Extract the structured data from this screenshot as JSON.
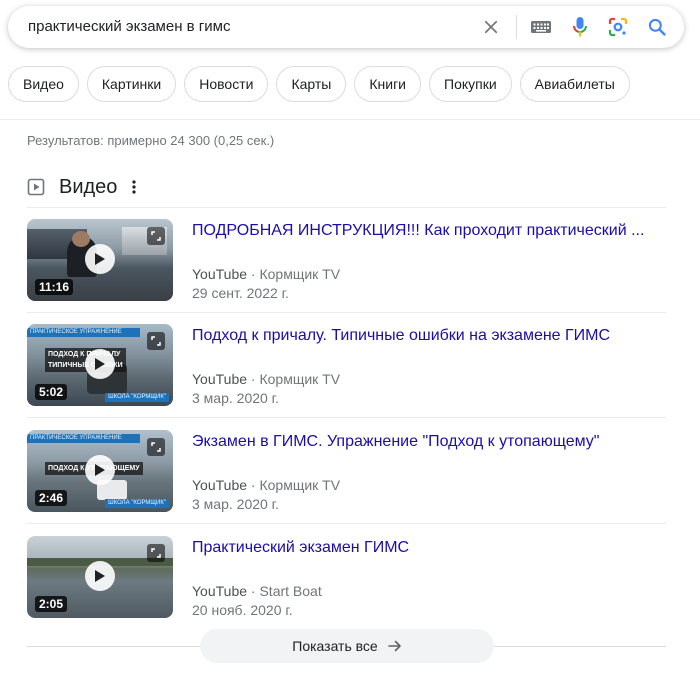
{
  "search": {
    "query": "практический экзамен в гимс"
  },
  "chips": [
    "Видео",
    "Картинки",
    "Новости",
    "Карты",
    "Книги",
    "Покупки",
    "Авиабилеты"
  ],
  "result_stats": "Результатов: примерно 24 300 (0,25 сек.)",
  "videos_section": {
    "title": "Видео",
    "items": [
      {
        "title": "ПОДРОБНАЯ ИНСТРУКЦИЯ!!! Как проходит практический ...",
        "platform": "YouTube",
        "channel": "Кормщик TV",
        "date": "29 сент. 2022 г.",
        "duration": "11:16"
      },
      {
        "title": "Подход к причалу. Типичные ошибки на экзамене ГИМС",
        "platform": "YouTube",
        "channel": "Кормщик TV",
        "date": "3 мар. 2020 г.",
        "duration": "5:02",
        "thumb_band": "ПРАКТИЧЕСКОЕ УПРАЖНЕНИЕ",
        "thumb_caption_1": "ПОДХОД К ПРИЧАЛУ",
        "thumb_caption_2": "ТИПИЧНЫЕ ОШИБКИ",
        "thumb_brand": "ШКОЛА \"КОРМЩИК\""
      },
      {
        "title": "Экзамен в ГИМС. Упражнение \"Подход к утопающему\"",
        "platform": "YouTube",
        "channel": "Кормщик TV",
        "date": "3 мар. 2020 г.",
        "duration": "2:46",
        "thumb_band": "ПРАКТИЧЕСКОЕ УПРАЖНЕНИЕ",
        "thumb_caption_1": "ПОДХОД К УТОПАЮЩЕМУ",
        "thumb_brand": "ШКОЛА \"КОРМЩИК\""
      },
      {
        "title": "Практический экзамен ГИМС",
        "platform": "YouTube",
        "channel": "Start Boat",
        "date": "20 нояб. 2020 г.",
        "duration": "2:05"
      }
    ],
    "show_all": "Показать все"
  },
  "colors": {
    "link": "#1a0dab",
    "mic_blue": "#4285f4",
    "mic_red": "#ea4335",
    "lens_yellow": "#fbbc04",
    "lens_green": "#34a853"
  }
}
